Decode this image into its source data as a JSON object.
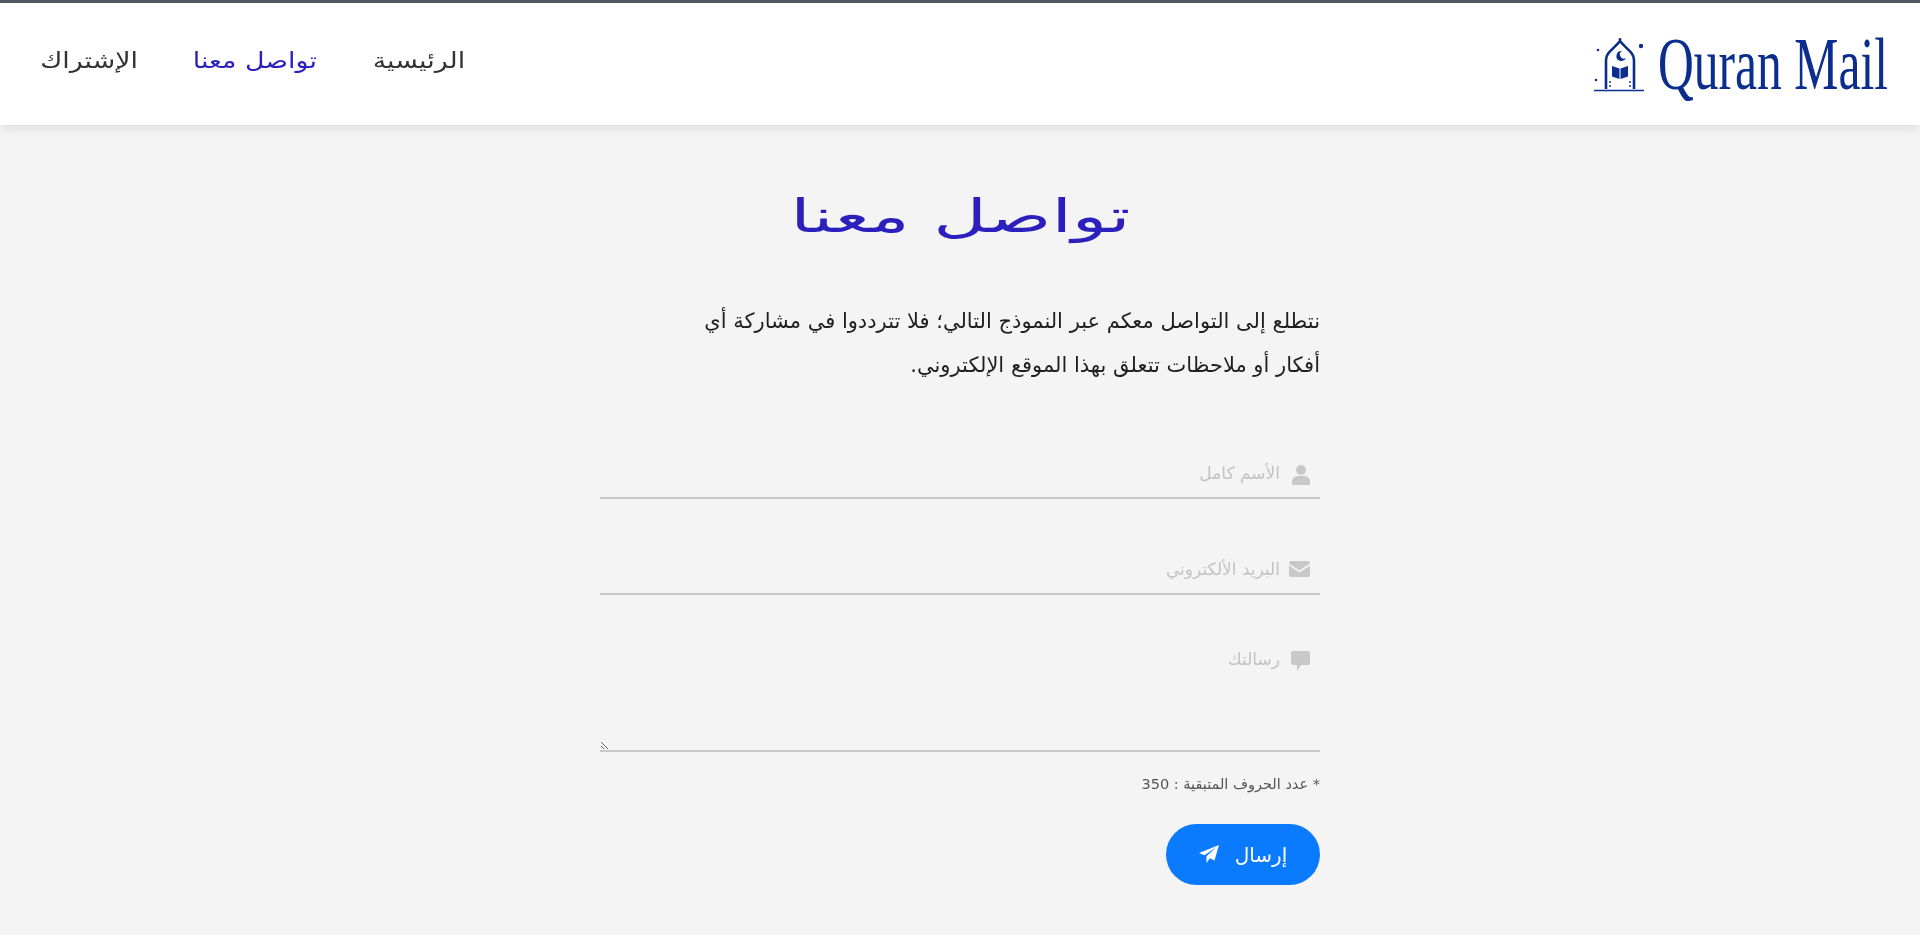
{
  "header": {
    "logo": {
      "text": "Quran Mail"
    },
    "nav": [
      {
        "label": "الرئيسية",
        "selected": false
      },
      {
        "label": "تواصل معنا",
        "selected": true
      },
      {
        "label": "الإشتراك",
        "selected": false
      }
    ]
  },
  "contact": {
    "title": "تواصل معنا",
    "intro": "نتطلع إلى التواصل معكم عبر النموذج التالي؛ فلا تترددوا في مشاركة أي أفكار أو ملاحظات تتعلق بهذا الموقع الإلكتروني.",
    "fields": [
      {
        "kind": "text",
        "placeholder": "الأسم كامل"
      },
      {
        "kind": "email",
        "placeholder": "البريد الألكتروني"
      },
      {
        "kind": "textarea",
        "placeholder": "رسالتك"
      }
    ],
    "counter": "* عدد الحروف المتبقية : 350",
    "submit": {
      "label": "إرسال"
    }
  }
}
